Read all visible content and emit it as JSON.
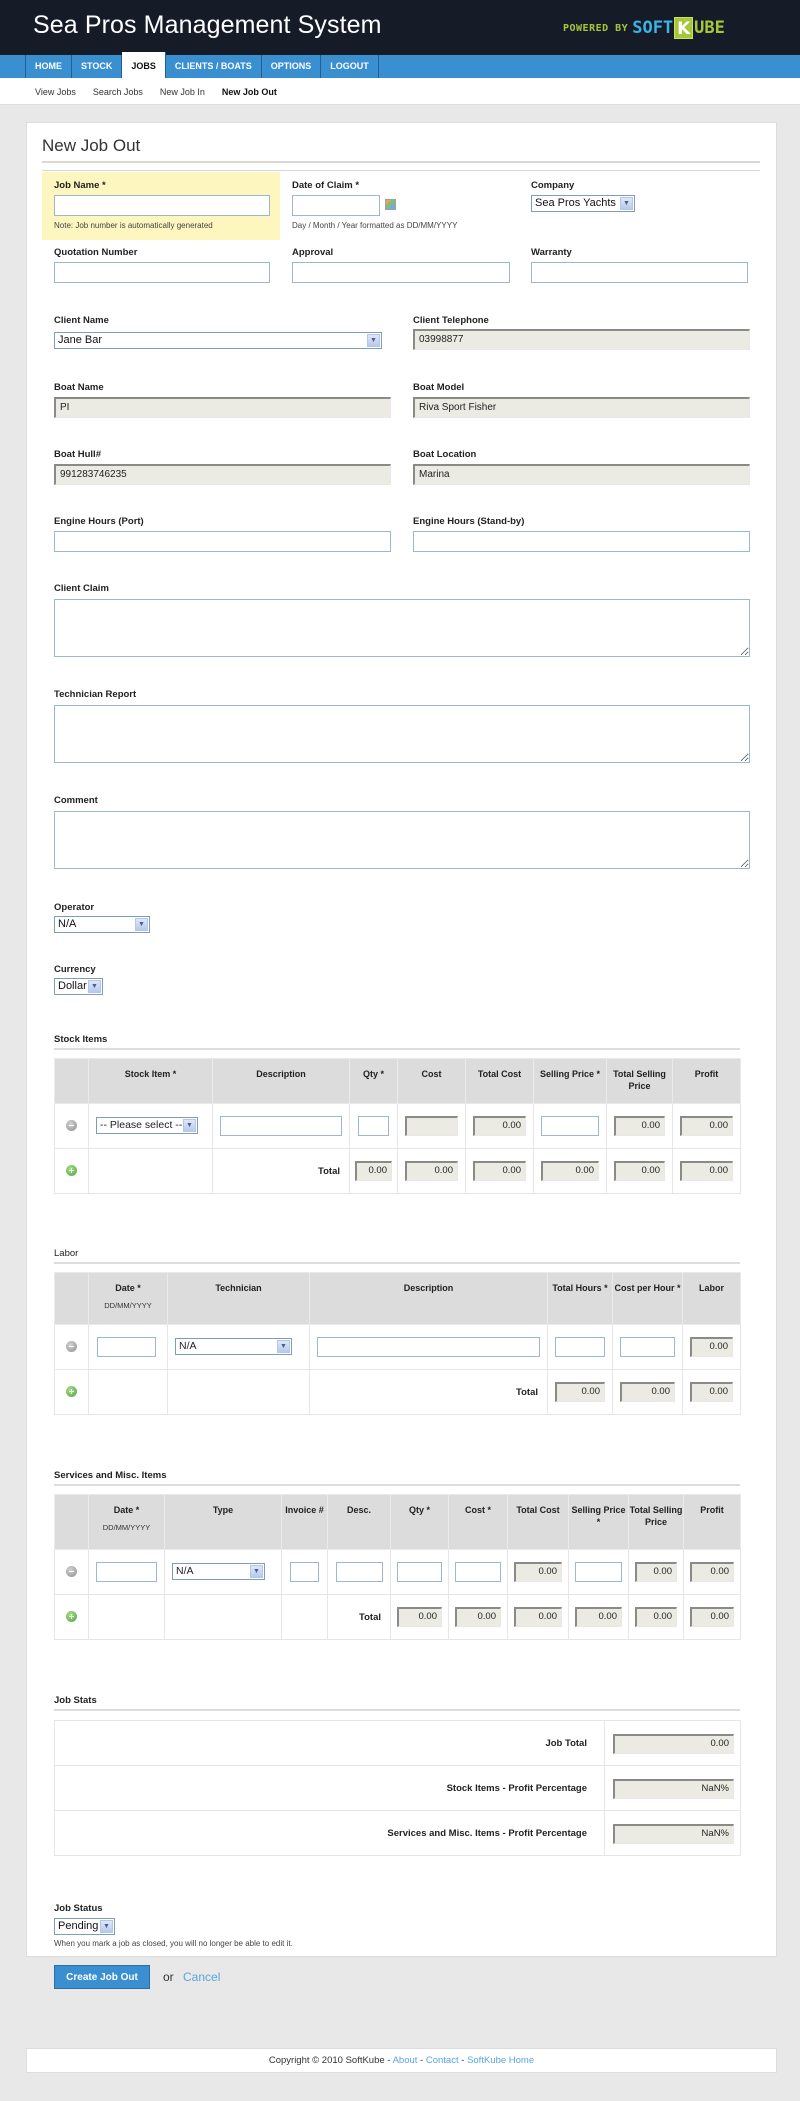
{
  "header": {
    "title": "Sea Pros Management System",
    "powered_by": "POWERED BY",
    "brand_soft": "SOFT",
    "brand_k": "K",
    "brand_ube": "UBE"
  },
  "nav": {
    "items": [
      {
        "label": "HOME",
        "active": false
      },
      {
        "label": "STOCK",
        "active": false
      },
      {
        "label": "JOBS",
        "active": true
      },
      {
        "label": "CLIENTS / BOATS",
        "active": false
      },
      {
        "label": "OPTIONS",
        "active": false
      },
      {
        "label": "LOGOUT",
        "active": false
      }
    ]
  },
  "subnav": {
    "items": [
      {
        "label": "View Jobs",
        "active": false
      },
      {
        "label": "Search Jobs",
        "active": false
      },
      {
        "label": "New Job In",
        "active": false
      },
      {
        "label": "New Job Out",
        "active": true
      }
    ]
  },
  "page": {
    "title": "New Job Out"
  },
  "form": {
    "job_name": {
      "label": "Job Name *",
      "value": "",
      "note": "Note: Job number is automatically generated"
    },
    "date_of_claim": {
      "label": "Date of Claim *",
      "value": "",
      "note": "Day / Month / Year formatted as DD/MM/YYYY"
    },
    "company": {
      "label": "Company",
      "value": "Sea Pros Yachts"
    },
    "quotation_number": {
      "label": "Quotation Number",
      "value": ""
    },
    "approval": {
      "label": "Approval",
      "value": ""
    },
    "warranty": {
      "label": "Warranty",
      "value": ""
    },
    "client_name": {
      "label": "Client Name",
      "value": "Jane Bar"
    },
    "client_telephone": {
      "label": "Client Telephone",
      "value": "03998877"
    },
    "boat_name": {
      "label": "Boat Name",
      "value": "PI"
    },
    "boat_model": {
      "label": "Boat Model",
      "value": "Riva Sport Fisher"
    },
    "boat_hull": {
      "label": "Boat Hull#",
      "value": "991283746235"
    },
    "boat_location": {
      "label": "Boat Location",
      "value": "Marina"
    },
    "engine_port": {
      "label": "Engine Hours (Port)",
      "value": ""
    },
    "engine_standby": {
      "label": "Engine Hours (Stand-by)",
      "value": ""
    },
    "client_claim": {
      "label": "Client Claim",
      "value": ""
    },
    "technician_report": {
      "label": "Technician Report",
      "value": ""
    },
    "comment": {
      "label": "Comment",
      "value": ""
    },
    "operator": {
      "label": "Operator",
      "value": "N/A"
    },
    "currency": {
      "label": "Currency",
      "value": "Dollar"
    }
  },
  "stock_items": {
    "title": "Stock Items",
    "headers": [
      "",
      "Stock Item *",
      "Description",
      "Qty *",
      "Cost",
      "Total Cost",
      "Selling Price *",
      "Total Selling Price",
      "Profit"
    ],
    "row": {
      "stock_item": "-- Please select --",
      "description": "",
      "qty": "",
      "cost": "",
      "total_cost": "0.00",
      "selling_price": "",
      "total_selling_price": "0.00",
      "profit": "0.00"
    },
    "total_label": "Total",
    "totals": {
      "qty": "0.00",
      "cost": "0.00",
      "total_cost": "0.00",
      "selling_price": "0.00",
      "total_selling_price": "0.00",
      "profit": "0.00"
    }
  },
  "labor": {
    "title": "Labor",
    "headers": [
      "",
      "Date *",
      "Technician",
      "Description",
      "Total Hours *",
      "Cost per Hour *",
      "Labor"
    ],
    "date_format": "DD/MM/YYYY",
    "row": {
      "date": "",
      "technician": "N/A",
      "description": "",
      "total_hours": "",
      "cost_per_hour": "",
      "labor": "0.00"
    },
    "total_label": "Total",
    "totals": {
      "total_hours": "0.00",
      "cost_per_hour": "0.00",
      "labor": "0.00"
    }
  },
  "services": {
    "title": "Services and Misc. Items",
    "headers": [
      "",
      "Date *",
      "Type",
      "Invoice #",
      "Desc.",
      "Qty *",
      "Cost *",
      "Total Cost",
      "Selling Price *",
      "Total Selling Price",
      "Profit"
    ],
    "date_format": "DD/MM/YYYY",
    "row": {
      "date": "",
      "type": "N/A",
      "invoice": "",
      "desc": "",
      "qty": "",
      "cost": "",
      "total_cost": "0.00",
      "selling_price": "",
      "total_selling_price": "0.00",
      "profit": "0.00"
    },
    "total_label": "Total",
    "totals": {
      "qty": "0.00",
      "cost": "0.00",
      "total_cost": "0.00",
      "selling_price": "0.00",
      "total_selling_price": "0.00",
      "profit": "0.00"
    }
  },
  "job_stats": {
    "title": "Job Stats",
    "rows": [
      {
        "label": "Job Total",
        "value": "0.00"
      },
      {
        "label": "Stock Items - Profit Percentage",
        "value": "NaN%"
      },
      {
        "label": "Services and Misc. Items - Profit Percentage",
        "value": "NaN%"
      }
    ]
  },
  "job_status": {
    "label": "Job Status",
    "value": "Pending",
    "note": "When you mark a job as closed, you will no longer be able to edit it."
  },
  "actions": {
    "create_label": "Create Job Out",
    "or_text": "or",
    "cancel_label": "Cancel"
  },
  "footer": {
    "copyright": "Copyright © 2010 SoftKube - ",
    "links": [
      "About",
      "Contact",
      "SoftKube Home"
    ],
    "sep": " - "
  }
}
